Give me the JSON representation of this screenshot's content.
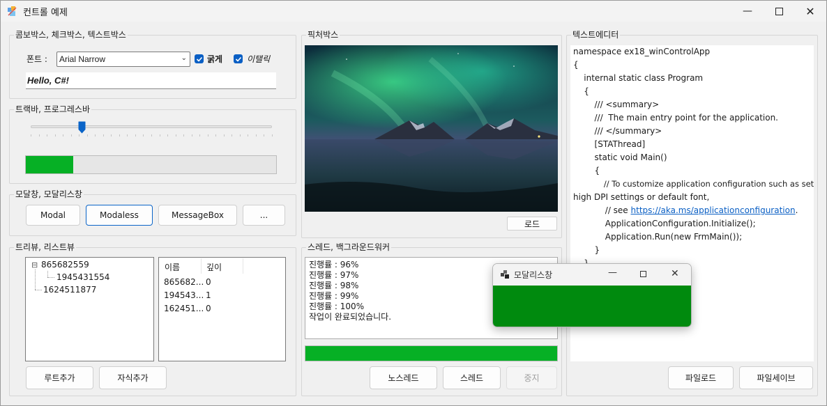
{
  "window": {
    "title": "컨트롤 예제"
  },
  "combo_group": {
    "label": "콤보박스, 체크박스, 텍스트박스",
    "font_label": "폰트 :",
    "font_value": "Arial Narrow",
    "bold_label": "굵게",
    "italic_label": "이탤릭",
    "text_value": "Hello, C#!"
  },
  "trackbar_group": {
    "label": "트랙바, 프로그레스바",
    "trackbar_value_fraction": 0.21,
    "progress_value_fraction": 0.19
  },
  "modal_group": {
    "label": "모달창, 모달리스창",
    "buttons": [
      "Modal",
      "Modaless",
      "MessageBox",
      "..."
    ]
  },
  "tree_group": {
    "label": "트리뷰, 리스트뷰",
    "tree": [
      {
        "text": "865682559",
        "expander": "⊟",
        "children": [
          {
            "text": "1945431554"
          }
        ]
      },
      {
        "text": "1624511877"
      }
    ],
    "list_columns": [
      "이름",
      "깊이"
    ],
    "list_rows": [
      {
        "name": "865682...",
        "depth": "0"
      },
      {
        "name": "194543...",
        "depth": "1"
      },
      {
        "name": "162451...",
        "depth": "0"
      }
    ],
    "add_root_button": "루트추가",
    "add_child_button": "자식추가"
  },
  "picture_group": {
    "label": "픽처박스",
    "load_button": "로드"
  },
  "thread_group": {
    "label": "스레드, 백그라운드워커",
    "log_lines": [
      "진행률 : 96%",
      "진행률 : 97%",
      "진행률 : 98%",
      "진행률 : 99%",
      "진행률 : 100%",
      "작업이 완료되었습니다."
    ],
    "progress_value_fraction": 1.0,
    "no_thread_button": "노스레드",
    "thread_button": "스레드",
    "stop_button": "중지"
  },
  "editor_group": {
    "label": "텍스트에디터",
    "lines": [
      "namespace ex18_winControlApp",
      "{",
      "    internal static class Program",
      "    {",
      "        /// <summary>",
      "        ///  The main entry point for the application.",
      "        /// </summary>",
      "        [STAThread]",
      "        static void Main()",
      "        {",
      "            // To customize application configuration such as set",
      "high DPI settings or default font,",
      "            // see ",
      "            ApplicationConfiguration.Initialize();",
      "            Application.Run(new FrmMain());",
      "        }",
      "    }"
    ],
    "link_text": "https://aka.ms/applicationconfiguration",
    "link_suffix": ".",
    "file_load_button": "파일로드",
    "file_save_button": "파일세이브"
  },
  "modeless_window": {
    "title": "모달리스창",
    "body_color": "#008a0e"
  },
  "colors": {
    "accent": "#0a5fc4",
    "progress_green": "#06b025"
  }
}
